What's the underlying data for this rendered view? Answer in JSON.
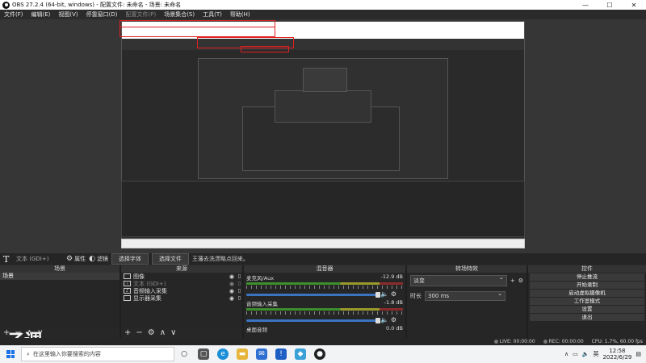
{
  "window": {
    "title": "OBS 27.2.4 (64-bit, windows) - 配置文件: 未命名 - 场景: 未命名",
    "min": "—",
    "max": "☐",
    "close": "✕"
  },
  "menu": [
    "文件(F)",
    "编辑(E)",
    "视图(V)",
    "停靠窗口(D)",
    "配置文件(P)",
    "场景集合(S)",
    "工具(T)",
    "帮助(H)"
  ],
  "filterbar": {
    "source_name": "文本 (GDI+)",
    "properties": "属性",
    "filters": "滤镜",
    "select_font": "选择字体",
    "select_file": "选择文件",
    "text_value": "王藩去洗漂略点回来。"
  },
  "scenes": {
    "title": "场景",
    "items": [
      "场景"
    ]
  },
  "sources": {
    "title": "来源",
    "items": [
      {
        "label": "图像",
        "icon": "image-icon",
        "dim": false
      },
      {
        "label": "文本 (GDI+)",
        "icon": "text-icon",
        "dim": true
      },
      {
        "label": "音频输入采集",
        "icon": "mic-icon",
        "dim": false
      },
      {
        "label": "显示器采集",
        "icon": "monitor-icon",
        "dim": false
      }
    ]
  },
  "mixer": {
    "title": "混音器",
    "channels": [
      {
        "name": "麦克风/Aux",
        "level": "-12.9 dB"
      },
      {
        "name": "音频输入采集",
        "level": "-1.8 dB"
      },
      {
        "name": "桌面音频",
        "level": "0.0 dB"
      }
    ]
  },
  "transitions": {
    "title": "转场特效",
    "type": "淡变",
    "duration_label": "时长",
    "duration_value": "300 ms"
  },
  "controls": {
    "title": "控件",
    "buttons": [
      "停止推流",
      "开始录制",
      "启动虚拟摄像机",
      "工作室模式",
      "设置",
      "退出"
    ]
  },
  "status": {
    "live": "LIVE: 00:00:00",
    "rec": "REC: 00:00:00",
    "cpu": "CPU: 1.7%, 60.00 fps"
  },
  "taskbar": {
    "search_placeholder": "在这里输入你要搜索的内容",
    "lang": "英",
    "time": "12:58",
    "date": "2022/6/29"
  },
  "watermark": "乙调",
  "footer_icons": {
    "add": "+",
    "remove": "−",
    "up": "∧",
    "down": "∨",
    "gear": "⚙"
  }
}
